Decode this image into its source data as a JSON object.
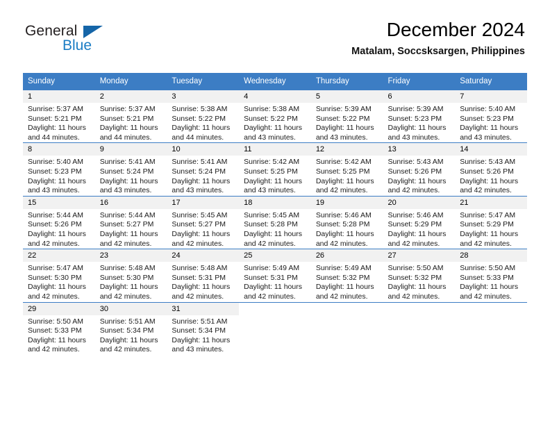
{
  "brand": {
    "name_primary": "General",
    "name_secondary": "Blue",
    "accent_color": "#1a7cc4",
    "header_color": "#3c7dc4"
  },
  "header": {
    "title": "December 2024",
    "subtitle": "Matalam, Soccsksargen, Philippines"
  },
  "weekday_headers": [
    "Sunday",
    "Monday",
    "Tuesday",
    "Wednesday",
    "Thursday",
    "Friday",
    "Saturday"
  ],
  "labels": {
    "sunrise_prefix": "Sunrise: ",
    "sunset_prefix": "Sunset: ",
    "daylight_prefix": "Daylight: "
  },
  "weeks": [
    [
      {
        "day": "1",
        "sunrise": "Sunrise: 5:37 AM",
        "sunset": "Sunset: 5:21 PM",
        "daylight": "Daylight: 11 hours and 44 minutes."
      },
      {
        "day": "2",
        "sunrise": "Sunrise: 5:37 AM",
        "sunset": "Sunset: 5:21 PM",
        "daylight": "Daylight: 11 hours and 44 minutes."
      },
      {
        "day": "3",
        "sunrise": "Sunrise: 5:38 AM",
        "sunset": "Sunset: 5:22 PM",
        "daylight": "Daylight: 11 hours and 44 minutes."
      },
      {
        "day": "4",
        "sunrise": "Sunrise: 5:38 AM",
        "sunset": "Sunset: 5:22 PM",
        "daylight": "Daylight: 11 hours and 43 minutes."
      },
      {
        "day": "5",
        "sunrise": "Sunrise: 5:39 AM",
        "sunset": "Sunset: 5:22 PM",
        "daylight": "Daylight: 11 hours and 43 minutes."
      },
      {
        "day": "6",
        "sunrise": "Sunrise: 5:39 AM",
        "sunset": "Sunset: 5:23 PM",
        "daylight": "Daylight: 11 hours and 43 minutes."
      },
      {
        "day": "7",
        "sunrise": "Sunrise: 5:40 AM",
        "sunset": "Sunset: 5:23 PM",
        "daylight": "Daylight: 11 hours and 43 minutes."
      }
    ],
    [
      {
        "day": "8",
        "sunrise": "Sunrise: 5:40 AM",
        "sunset": "Sunset: 5:23 PM",
        "daylight": "Daylight: 11 hours and 43 minutes."
      },
      {
        "day": "9",
        "sunrise": "Sunrise: 5:41 AM",
        "sunset": "Sunset: 5:24 PM",
        "daylight": "Daylight: 11 hours and 43 minutes."
      },
      {
        "day": "10",
        "sunrise": "Sunrise: 5:41 AM",
        "sunset": "Sunset: 5:24 PM",
        "daylight": "Daylight: 11 hours and 43 minutes."
      },
      {
        "day": "11",
        "sunrise": "Sunrise: 5:42 AM",
        "sunset": "Sunset: 5:25 PM",
        "daylight": "Daylight: 11 hours and 43 minutes."
      },
      {
        "day": "12",
        "sunrise": "Sunrise: 5:42 AM",
        "sunset": "Sunset: 5:25 PM",
        "daylight": "Daylight: 11 hours and 42 minutes."
      },
      {
        "day": "13",
        "sunrise": "Sunrise: 5:43 AM",
        "sunset": "Sunset: 5:26 PM",
        "daylight": "Daylight: 11 hours and 42 minutes."
      },
      {
        "day": "14",
        "sunrise": "Sunrise: 5:43 AM",
        "sunset": "Sunset: 5:26 PM",
        "daylight": "Daylight: 11 hours and 42 minutes."
      }
    ],
    [
      {
        "day": "15",
        "sunrise": "Sunrise: 5:44 AM",
        "sunset": "Sunset: 5:26 PM",
        "daylight": "Daylight: 11 hours and 42 minutes."
      },
      {
        "day": "16",
        "sunrise": "Sunrise: 5:44 AM",
        "sunset": "Sunset: 5:27 PM",
        "daylight": "Daylight: 11 hours and 42 minutes."
      },
      {
        "day": "17",
        "sunrise": "Sunrise: 5:45 AM",
        "sunset": "Sunset: 5:27 PM",
        "daylight": "Daylight: 11 hours and 42 minutes."
      },
      {
        "day": "18",
        "sunrise": "Sunrise: 5:45 AM",
        "sunset": "Sunset: 5:28 PM",
        "daylight": "Daylight: 11 hours and 42 minutes."
      },
      {
        "day": "19",
        "sunrise": "Sunrise: 5:46 AM",
        "sunset": "Sunset: 5:28 PM",
        "daylight": "Daylight: 11 hours and 42 minutes."
      },
      {
        "day": "20",
        "sunrise": "Sunrise: 5:46 AM",
        "sunset": "Sunset: 5:29 PM",
        "daylight": "Daylight: 11 hours and 42 minutes."
      },
      {
        "day": "21",
        "sunrise": "Sunrise: 5:47 AM",
        "sunset": "Sunset: 5:29 PM",
        "daylight": "Daylight: 11 hours and 42 minutes."
      }
    ],
    [
      {
        "day": "22",
        "sunrise": "Sunrise: 5:47 AM",
        "sunset": "Sunset: 5:30 PM",
        "daylight": "Daylight: 11 hours and 42 minutes."
      },
      {
        "day": "23",
        "sunrise": "Sunrise: 5:48 AM",
        "sunset": "Sunset: 5:30 PM",
        "daylight": "Daylight: 11 hours and 42 minutes."
      },
      {
        "day": "24",
        "sunrise": "Sunrise: 5:48 AM",
        "sunset": "Sunset: 5:31 PM",
        "daylight": "Daylight: 11 hours and 42 minutes."
      },
      {
        "day": "25",
        "sunrise": "Sunrise: 5:49 AM",
        "sunset": "Sunset: 5:31 PM",
        "daylight": "Daylight: 11 hours and 42 minutes."
      },
      {
        "day": "26",
        "sunrise": "Sunrise: 5:49 AM",
        "sunset": "Sunset: 5:32 PM",
        "daylight": "Daylight: 11 hours and 42 minutes."
      },
      {
        "day": "27",
        "sunrise": "Sunrise: 5:50 AM",
        "sunset": "Sunset: 5:32 PM",
        "daylight": "Daylight: 11 hours and 42 minutes."
      },
      {
        "day": "28",
        "sunrise": "Sunrise: 5:50 AM",
        "sunset": "Sunset: 5:33 PM",
        "daylight": "Daylight: 11 hours and 42 minutes."
      }
    ],
    [
      {
        "day": "29",
        "sunrise": "Sunrise: 5:50 AM",
        "sunset": "Sunset: 5:33 PM",
        "daylight": "Daylight: 11 hours and 42 minutes."
      },
      {
        "day": "30",
        "sunrise": "Sunrise: 5:51 AM",
        "sunset": "Sunset: 5:34 PM",
        "daylight": "Daylight: 11 hours and 42 minutes."
      },
      {
        "day": "31",
        "sunrise": "Sunrise: 5:51 AM",
        "sunset": "Sunset: 5:34 PM",
        "daylight": "Daylight: 11 hours and 43 minutes."
      },
      {
        "day": "",
        "sunrise": "",
        "sunset": "",
        "daylight": ""
      },
      {
        "day": "",
        "sunrise": "",
        "sunset": "",
        "daylight": ""
      },
      {
        "day": "",
        "sunrise": "",
        "sunset": "",
        "daylight": ""
      },
      {
        "day": "",
        "sunrise": "",
        "sunset": "",
        "daylight": ""
      }
    ]
  ]
}
